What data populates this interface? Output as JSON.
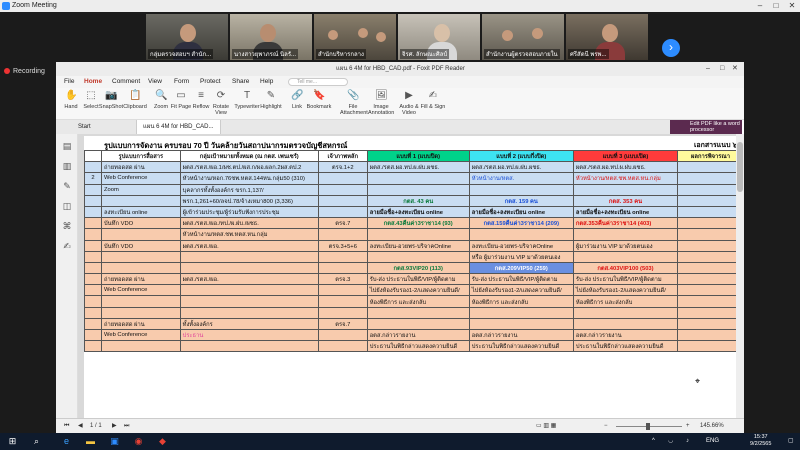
{
  "zoom": {
    "title": "Zoom Meeting",
    "recording": "Recording",
    "participants": [
      {
        "name": "กลุ่มตรวจสอบฯ สำนัก..."
      },
      {
        "name": "นางสาวยุพาภรณ์ นิลรั..."
      },
      {
        "name": "สำนักบริหารกลาง"
      },
      {
        "name": "จิรศ. ลักษณะศิลป์"
      },
      {
        "name": "สำนักงานผู้ตรวจสอบภายใน"
      },
      {
        "name": "ศรีสัดนี พรพ..."
      }
    ]
  },
  "foxit": {
    "title": "แผน 6 4M for HBD_CAD.pdf - Foxit PDF Reader",
    "menu": [
      "File",
      "Home",
      "Comment",
      "View",
      "Form",
      "Protect",
      "Share",
      "Help"
    ],
    "active_menu": "Home",
    "search_placeholder": "Tell me...",
    "ribbon": [
      {
        "label": "Hand",
        "icon": "✋"
      },
      {
        "label": "Select",
        "icon": "⬚"
      },
      {
        "label": "SnapShot",
        "icon": "📷"
      },
      {
        "label": "Clipboard",
        "icon": "📋"
      },
      {
        "label": "Zoom",
        "icon": "🔍"
      },
      {
        "label": "Fit Page",
        "icon": "▭"
      },
      {
        "label": "Reflow",
        "icon": "≡"
      },
      {
        "label": "Rotate View",
        "icon": "⟳"
      },
      {
        "label": "Typewriter",
        "icon": "T"
      },
      {
        "label": "Highlight",
        "icon": "✎"
      },
      {
        "label": "Link",
        "icon": "🔗"
      },
      {
        "label": "Bookmark",
        "icon": "🔖"
      },
      {
        "label": "File Attachment",
        "icon": "📎"
      },
      {
        "label": "Image Annotation",
        "icon": "🖼"
      },
      {
        "label": "Audio & Video",
        "icon": "▶"
      },
      {
        "label": "Fill & Sign",
        "icon": "✍"
      }
    ],
    "tabs": [
      "Start",
      "แผน 6 4M for HBD_CAD..."
    ],
    "edit_banner": "Edit PDF like a word processor",
    "page_indicator": "1 / 1",
    "zoom_level": "145.66%"
  },
  "document": {
    "title": "รูปแบบการจัดงาน ครบรอบ 70 ปี วันคล้ายวันสถาปนากรมตรวจบัญชีสหกรณ์",
    "ref": "เอกสารแนบ ๖",
    "headers": [
      "",
      "รูปแบบการสื่อสาร",
      "กลุ่มเป้าหมาย/ทั้งหมด (ณ กตส. เพนเซร์)",
      "เจ้าภาพหลัก",
      "แบบที่ 1 (แบบปิด)",
      "แบบที่ 2 (แบบกึ่งปิด)",
      "แบบที่ 3 (แบบเปิด)",
      "ผลการพิจารณา"
    ],
    "rows": [
      {
        "style": "blue",
        "cells": [
          "",
          "ถ่ายทอดสด ผ่าน",
          "ผตส./รตส./ผอ.1/ผช.ตป./ผส.ก/ผอ.ผลก.2ผส.ตป.2",
          "ตรจ.1+2",
          "ผตส./รตส.ผอ.ทป.ผ.ฝบ.ผชธ.",
          "ผตส./รตส.ผอ.ทป.ผ.ฝบ.ผชธ.",
          "ผตส./รตส.ผอ.ทป.ผ.ฝบ.ผชธ.",
          ""
        ]
      },
      {
        "style": "blue",
        "cells": [
          "2",
          "Web Conference",
          "หัวหน้างาน/หอก.76ชพ.หตส.144หน.กลุ่ม50 (310)",
          "",
          "",
          "หัวหน้างาน/หตส.",
          "หัวหน้างาน/หตส.ชพ.หตส.หน.กลุ่ม",
          ""
        ]
      },
      {
        "style": "blue",
        "cells": [
          "",
          "Zoom",
          "บุคลากรทั้งทั้งองค์กร ขรก.1,137/",
          "",
          "",
          "",
          "",
          ""
        ]
      },
      {
        "style": "blue",
        "cells": [
          "",
          "",
          "พรก.1,261+60/ลจป.78/จ้างเหมา800 (3,336)",
          "",
          "กตส. 43 คน",
          "กตส. 159 คน",
          "กตส. 353 คน",
          ""
        ]
      },
      {
        "style": "blue",
        "cells": [
          "",
          "ลงทะเบียน online",
          "ผู้เข้าร่วมประชุม/ผู้ร่วมรับฟังการประชุม",
          "",
          "ลายมือชื่อ+ลงทะเบียน online",
          "ลายมือชื่อ+ลงทะเบียน online",
          "ลายมือชื่อ+ลงทะเบียน online",
          ""
        ]
      },
      {
        "style": "orange",
        "cells": [
          "",
          "บันทึก VDO",
          "ผตส./รตส./ผอ./ทป./ผ.ฝบ./ผชธ.",
          "ตรจ.7",
          "กตส.43คืนค่า3ราชา14 (93)",
          "กตส.159คืนค่า3ราชา14 (209)",
          "กตส.353คืนค่า3ราชา14 (403)",
          ""
        ]
      },
      {
        "style": "orange",
        "cells": [
          "",
          "",
          "หัวหน้างาน/หตส.ชพ.หตส.หน.กลุ่ม",
          "",
          "",
          "",
          "",
          ""
        ]
      },
      {
        "style": "orange",
        "cells": [
          "",
          "บันทึก VDO",
          "ผตส./รตส./ผอ.",
          "ตรจ.3+5+6",
          "ลงทะเบียน-อวยพร-บริจาคOnline",
          "ลงทะเบียน-อวยพร-บริจาคOnline",
          "ผู้มาร่วมงาน VIP มาด้วยตนเอง",
          ""
        ]
      },
      {
        "style": "orange",
        "cells": [
          "",
          "",
          "",
          "",
          "",
          "หรือ ผู้มาร่วมงาน VIP มาด้วยตนเอง",
          "",
          ""
        ]
      },
      {
        "style": "orange",
        "cells": [
          "",
          "",
          "",
          "",
          "กตส.93VIP20 (113)",
          "กตส.209VIP50 (259)",
          "กตส.403VIP100 (503)",
          ""
        ]
      },
      {
        "style": "orange",
        "cells": [
          "",
          "ถ่ายทอดสด ผ่าน",
          "ผตส./รตส./ผอ.",
          "ตรจ.3",
          "รับ-ส่ง ประธานในพิธี/VIP/ผู้ติดตาม",
          "รับ-ส่ง ประธานในพิธี/VIP/ผู้ติดตาม",
          "รับ-ส่ง ประธานในพิธี/VIP/ผู้ติดตาม",
          ""
        ]
      },
      {
        "style": "orange",
        "cells": [
          "",
          "Web Conference",
          "",
          "",
          "ไปยังห้องรับรอง1-2/แสดงความยินดี/",
          "ไปยังห้องรับรอง1-2/แสดงความยินดี/",
          "ไปยังห้องรับรอง1-2/แสดงความยินดี/",
          ""
        ]
      },
      {
        "style": "orange",
        "cells": [
          "",
          "",
          "",
          "",
          "ห้องพิธีการ และส่งกลับ",
          "ห้องพิธีการ และส่งกลับ",
          "ห้องพิธีการ และส่งกลับ",
          ""
        ]
      },
      {
        "style": "orange",
        "cells": [
          "",
          "",
          "",
          "",
          "",
          "",
          "",
          ""
        ]
      },
      {
        "style": "orange",
        "cells": [
          "",
          "ถ่ายทอดสด ผ่าน",
          "ทั้งทั้งองค์กร",
          "ตรจ.7",
          "",
          "",
          "",
          ""
        ]
      },
      {
        "style": "orange",
        "cells": [
          "",
          "Web Conference",
          "ประธาน",
          "",
          "อตส.กล่าวรายงาน",
          "อตส.กล่าวรายงาน",
          "อตส.กล่าวรายงาน",
          ""
        ]
      },
      {
        "style": "orange",
        "cells": [
          "",
          "",
          "",
          "",
          "ประธานในพิธีกล่าวแสดงความยินดี",
          "ประธานในพิธีกล่าวแสดงความยินดี",
          "ประธานในพิธีกล่าวแสดงความยินดี",
          ""
        ]
      }
    ]
  },
  "taskbar": {
    "tray_lang": "ENG",
    "time": "15:37",
    "date": "9/2/2565"
  },
  "colors": {
    "green_header": "#00d28a",
    "cyan_header": "#3de3f2",
    "red_header": "#ff3b3b",
    "yellow_header": "#fffa9c"
  }
}
